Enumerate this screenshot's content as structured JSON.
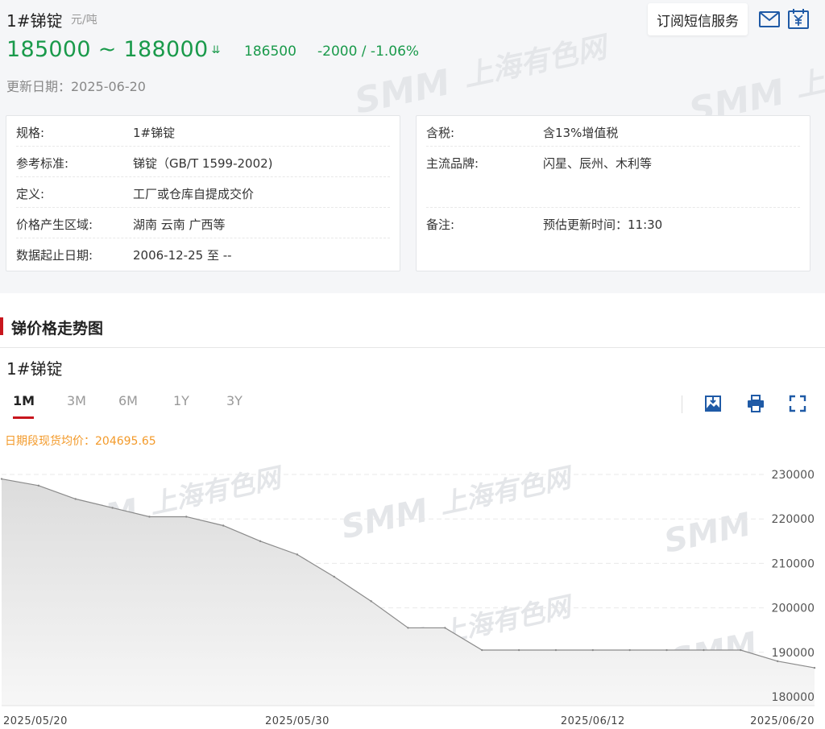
{
  "product": {
    "title": "1#锑锭",
    "unit": "元/吨",
    "price_range": "185000 ~ 188000",
    "avg_price": "186500",
    "change": "-2000 / -1.06%",
    "update_date": "更新日期：2025-06-20"
  },
  "header": {
    "subscribe_label": "订阅短信服务",
    "mail_icon": "mail-icon",
    "yuan_icon": "yuan-calendar-icon"
  },
  "spec_left": [
    {
      "key": "规格:",
      "value": "1#锑锭"
    },
    {
      "key": "参考标准:",
      "value": "锑锭（GB/T 1599-2002)"
    },
    {
      "key": "定义:",
      "value": "工厂或仓库自提成交价"
    },
    {
      "key": "价格产生区域:",
      "value": "湖南 云南 广西等"
    },
    {
      "key": "数据起止日期:",
      "value": "2006-12-25 至 --"
    }
  ],
  "spec_right": [
    {
      "key": "含税:",
      "value": "含13%增值税"
    },
    {
      "key": "主流品牌:",
      "value": "闪星、辰州、木利等"
    },
    {
      "key": "备注:",
      "value": "预估更新时间：11:30"
    }
  ],
  "section": {
    "title": "锑价格走势图"
  },
  "chart_panel": {
    "title": "1#锑锭",
    "ranges": [
      "1M",
      "3M",
      "6M",
      "1Y",
      "3Y"
    ],
    "active_range": "1M",
    "avg_note": "日期段现货均价：204695.65",
    "tools": [
      "download-image-icon",
      "print-icon",
      "fullscreen-icon"
    ]
  },
  "watermark": {
    "brand": "SMM",
    "cn": "上海有色网"
  },
  "colors": {
    "green": "#1a9a4b",
    "red": "#c8161d",
    "orange": "#f39a2a",
    "icon_blue": "#1f5aa6"
  },
  "chart_data": {
    "type": "area",
    "x": [
      "2025/05/20",
      "2025/05/21",
      "2025/05/22",
      "2025/05/23",
      "2025/05/26",
      "2025/05/27",
      "2025/05/28",
      "2025/05/29",
      "2025/05/30",
      "2025/06/03",
      "2025/06/04",
      "2025/06/05",
      "2025/06/06",
      "2025/06/09",
      "2025/06/10",
      "2025/06/11",
      "2025/06/12",
      "2025/06/13",
      "2025/06/16",
      "2025/06/17",
      "2025/06/18",
      "2025/06/19",
      "2025/06/20"
    ],
    "series": [
      {
        "values": [
          229000,
          227500,
          224500,
          222500,
          220500,
          220500,
          218500,
          215000,
          212000,
          207000,
          201500,
          195500,
          195500,
          190500,
          190500,
          190500,
          190500,
          190500,
          190500,
          190500,
          190500,
          188000,
          186500
        ]
      }
    ],
    "xticks": [
      "2025/05/20",
      "2025/05/30",
      "2025/06/12",
      "2025/06/20"
    ],
    "yticks": [
      180000,
      190000,
      200000,
      210000,
      220000,
      230000
    ],
    "ylim": [
      178000,
      232000
    ],
    "grid": true,
    "y_axis_side": "right"
  }
}
